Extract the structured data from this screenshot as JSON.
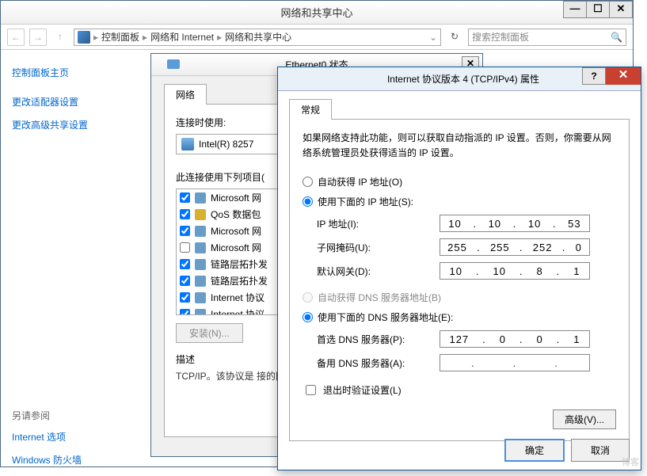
{
  "main_window": {
    "title": "网络和共享中心",
    "breadcrumb": [
      "控制面板",
      "网络和 Internet",
      "网络和共享中心"
    ],
    "search_placeholder": "搜索控制面板"
  },
  "sidebar": {
    "heading": "控制面板主页",
    "links": [
      "更改适配器设置",
      "更改高级共享设置"
    ],
    "see_also_label": "另请参阅",
    "see_also": [
      "Internet 选项",
      "Windows 防火墙"
    ]
  },
  "eth_window": {
    "title": "Ethernet0 状态",
    "tab": "网络",
    "connect_label": "连接时使用:",
    "adapter": "Intel(R) 8257",
    "items_label": "此连接使用下列项目(",
    "items": [
      {
        "checked": true,
        "icon": "b",
        "label": "Microsoft 网"
      },
      {
        "checked": true,
        "icon": "y",
        "label": "QoS 数据包"
      },
      {
        "checked": true,
        "icon": "b",
        "label": "Microsoft 网"
      },
      {
        "checked": false,
        "icon": "b",
        "label": "Microsoft 网"
      },
      {
        "checked": true,
        "icon": "b",
        "label": "链路层拓扑发"
      },
      {
        "checked": true,
        "icon": "b",
        "label": "链路层拓扑发"
      },
      {
        "checked": true,
        "icon": "b",
        "label": "Internet 协议"
      },
      {
        "checked": true,
        "icon": "b",
        "label": "Internet 协议"
      }
    ],
    "install_btn": "安装(N)...",
    "desc_label": "描述",
    "desc_text": "TCP/IP。该协议是\n接的网络上的通讯"
  },
  "ip_window": {
    "title": "Internet 协议版本 4 (TCP/IPv4) 属性",
    "tab": "常规",
    "info": "如果网络支持此功能，则可以获取自动指派的 IP 设置。否则，你需要从网络系统管理员处获得适当的 IP 设置。",
    "radio_auto_ip": "自动获得 IP 地址(O)",
    "radio_manual_ip": "使用下面的 IP 地址(S):",
    "ip_label": "IP 地址(I):",
    "ip_value": [
      "10",
      "10",
      "10",
      "53"
    ],
    "mask_label": "子网掩码(U):",
    "mask_value": [
      "255",
      "255",
      "252",
      "0"
    ],
    "gw_label": "默认网关(D):",
    "gw_value": [
      "10",
      "10",
      "8",
      "1"
    ],
    "radio_auto_dns": "自动获得 DNS 服务器地址(B)",
    "radio_manual_dns": "使用下面的 DNS 服务器地址(E):",
    "dns1_label": "首选 DNS 服务器(P):",
    "dns1_value": [
      "127",
      "0",
      "0",
      "1"
    ],
    "dns2_label": "备用 DNS 服务器(A):",
    "dns2_value": [
      "",
      "",
      "",
      ""
    ],
    "validate_label": "退出时验证设置(L)",
    "advanced_btn": "高级(V)...",
    "ok_btn": "确定",
    "cancel_btn": "取消"
  },
  "watermark": "博客"
}
